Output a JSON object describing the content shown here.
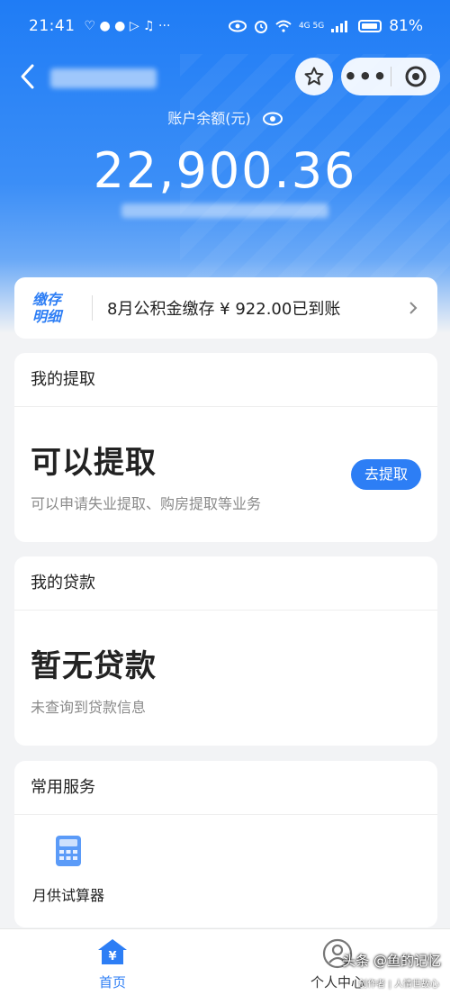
{
  "status_bar": {
    "time": "21:41",
    "left_icons": "♡ ● ● ▷ ♫ ···",
    "battery_percent": "81%",
    "network_labels": "4G 5G"
  },
  "nav": {
    "back_icon": "chevron-left-icon",
    "more_label": "•••"
  },
  "balance": {
    "label": "账户余额(元)",
    "value": "22,900.36"
  },
  "notice": {
    "badge_line1": "缴存",
    "badge_line2": "明细",
    "text": "8月公积金缴存 ¥ 922.00已到账"
  },
  "withdraw": {
    "heading": "我的提取",
    "status": "可以提取",
    "description": "可以申请失业提取、购房提取等业务",
    "button": "去提取"
  },
  "loan": {
    "heading": "我的贷款",
    "status": "暂无贷款",
    "description": "未查询到贷款信息"
  },
  "services": {
    "heading": "常用服务",
    "items": [
      {
        "label": "月供试算器",
        "icon": "calculator-icon"
      }
    ]
  },
  "tabbar": {
    "home": "首页",
    "profile": "个人中心"
  },
  "watermark": {
    "text": "头条 @鱼的记忆",
    "sub": "创作者 | 人情世故心"
  },
  "colors": {
    "accent": "#2d7ef5",
    "hero_top": "#1f7cf5",
    "background": "#f2f3f5"
  }
}
